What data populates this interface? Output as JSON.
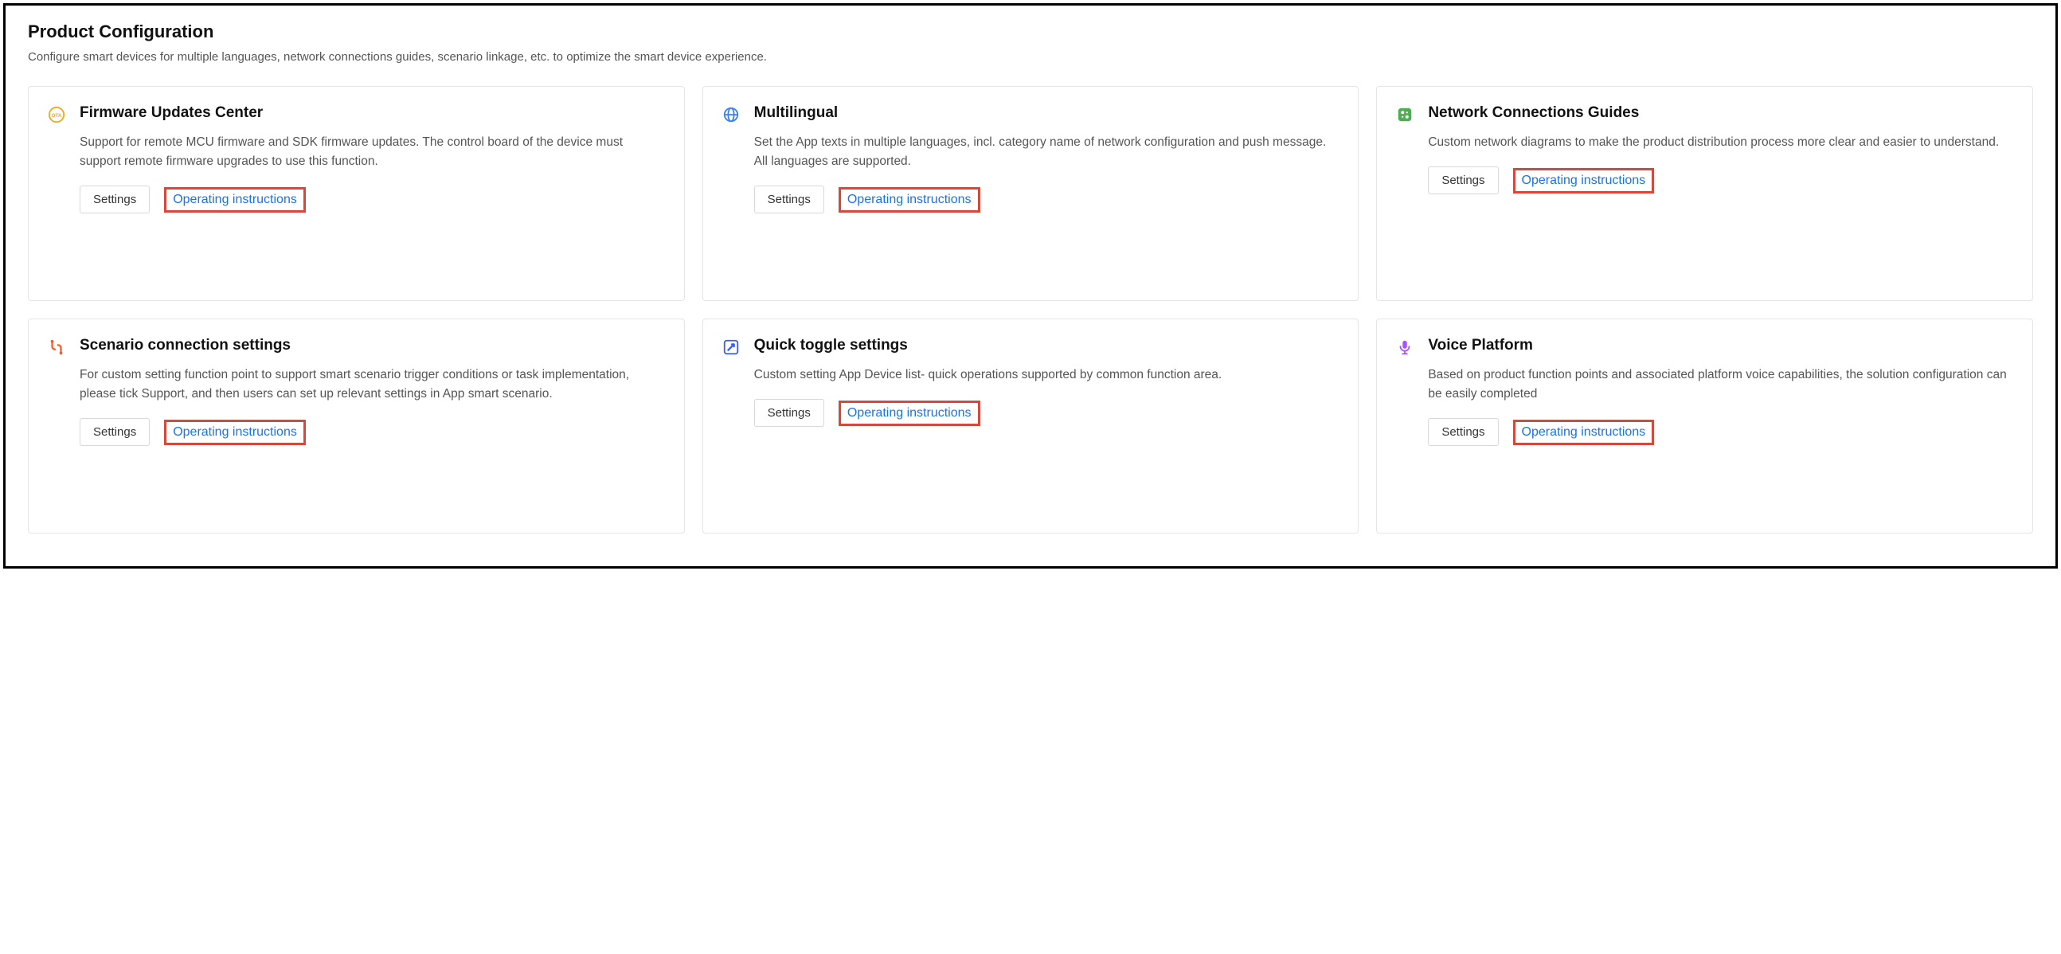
{
  "page": {
    "title": "Product Configuration",
    "subtitle": "Configure smart devices for multiple languages, network connections guides, scenario linkage, etc. to optimize the smart device experience."
  },
  "common": {
    "settings_label": "Settings",
    "instructions_label": "Operating instructions"
  },
  "cards": [
    {
      "icon": "ota-icon",
      "title": "Firmware Updates Center",
      "description": "Support for remote MCU firmware and SDK firmware updates. The control board of the device must support remote firmware upgrades to use this function."
    },
    {
      "icon": "globe-icon",
      "title": "Multilingual",
      "description": "Set the App texts in multiple languages, incl. category name of network configuration and push message. All languages are supported."
    },
    {
      "icon": "network-icon",
      "title": "Network Connections Guides",
      "description": "Custom network diagrams to make the product distribution process more clear and easier to understand."
    },
    {
      "icon": "scenario-icon",
      "title": "Scenario connection settings",
      "description": "For custom setting function point to support smart scenario trigger conditions or task implementation, please tick Support, and then users can set up relevant settings in App smart scenario."
    },
    {
      "icon": "toggle-icon",
      "title": "Quick toggle settings",
      "description": "Custom setting App Device list- quick operations supported by common function area."
    },
    {
      "icon": "voice-icon",
      "title": "Voice Platform",
      "description": "Based on product function points and associated platform voice capabilities, the solution configuration can be easily completed"
    }
  ]
}
